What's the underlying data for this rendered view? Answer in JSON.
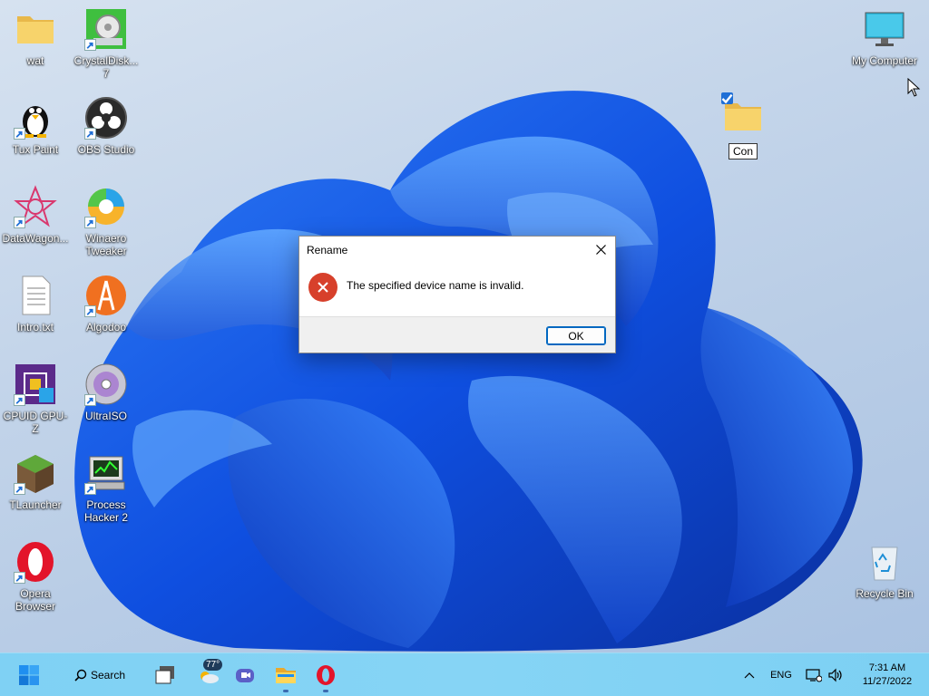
{
  "desktop": {
    "icons": [
      {
        "label": "wat",
        "icon": "folder-icon"
      },
      {
        "label": "CrystalDisk...\n7",
        "icon": "crystaldisk-icon"
      },
      {
        "label": "Tux Paint",
        "icon": "tux-icon"
      },
      {
        "label": "OBS Studio",
        "icon": "obs-icon"
      },
      {
        "label": "DataWagon...",
        "icon": "datawagon-icon"
      },
      {
        "label": "Winaero\nTweaker",
        "icon": "winaero-icon"
      },
      {
        "label": "Intro.txt",
        "icon": "text-file-icon"
      },
      {
        "label": "Algodoo",
        "icon": "algodoo-icon"
      },
      {
        "label": "CPUID GPU-Z",
        "icon": "gpuz-icon"
      },
      {
        "label": "UltraISO",
        "icon": "ultraiso-icon"
      },
      {
        "label": "TLauncher",
        "icon": "tlauncher-icon"
      },
      {
        "label": "Process\nHacker 2",
        "icon": "process-hacker-icon"
      },
      {
        "label": "Opera\nBrowser",
        "icon": "opera-icon"
      },
      {
        "label": "My Computer",
        "icon": "monitor-icon"
      },
      {
        "label": "Recycle Bin",
        "icon": "recycle-bin-icon"
      }
    ],
    "renaming_folder": {
      "value": "Con",
      "icon": "folder-icon",
      "selected": true
    }
  },
  "dialog": {
    "title": "Rename",
    "message": "The specified device name is invalid.",
    "ok_label": "OK",
    "icon": "error-icon"
  },
  "taskbar": {
    "search_label": "Search",
    "weather_temp": "77°",
    "apps": [
      "start-icon",
      "search-icon",
      "task-view-icon",
      "weather-icon",
      "meet-icon",
      "file-explorer-icon",
      "opera-icon"
    ],
    "language": "ENG",
    "time": "7:31 AM",
    "date": "11/27/2022"
  },
  "colors": {
    "accent": "#0067c0",
    "error": "#d7402b",
    "taskbar": "#80d2f4"
  }
}
